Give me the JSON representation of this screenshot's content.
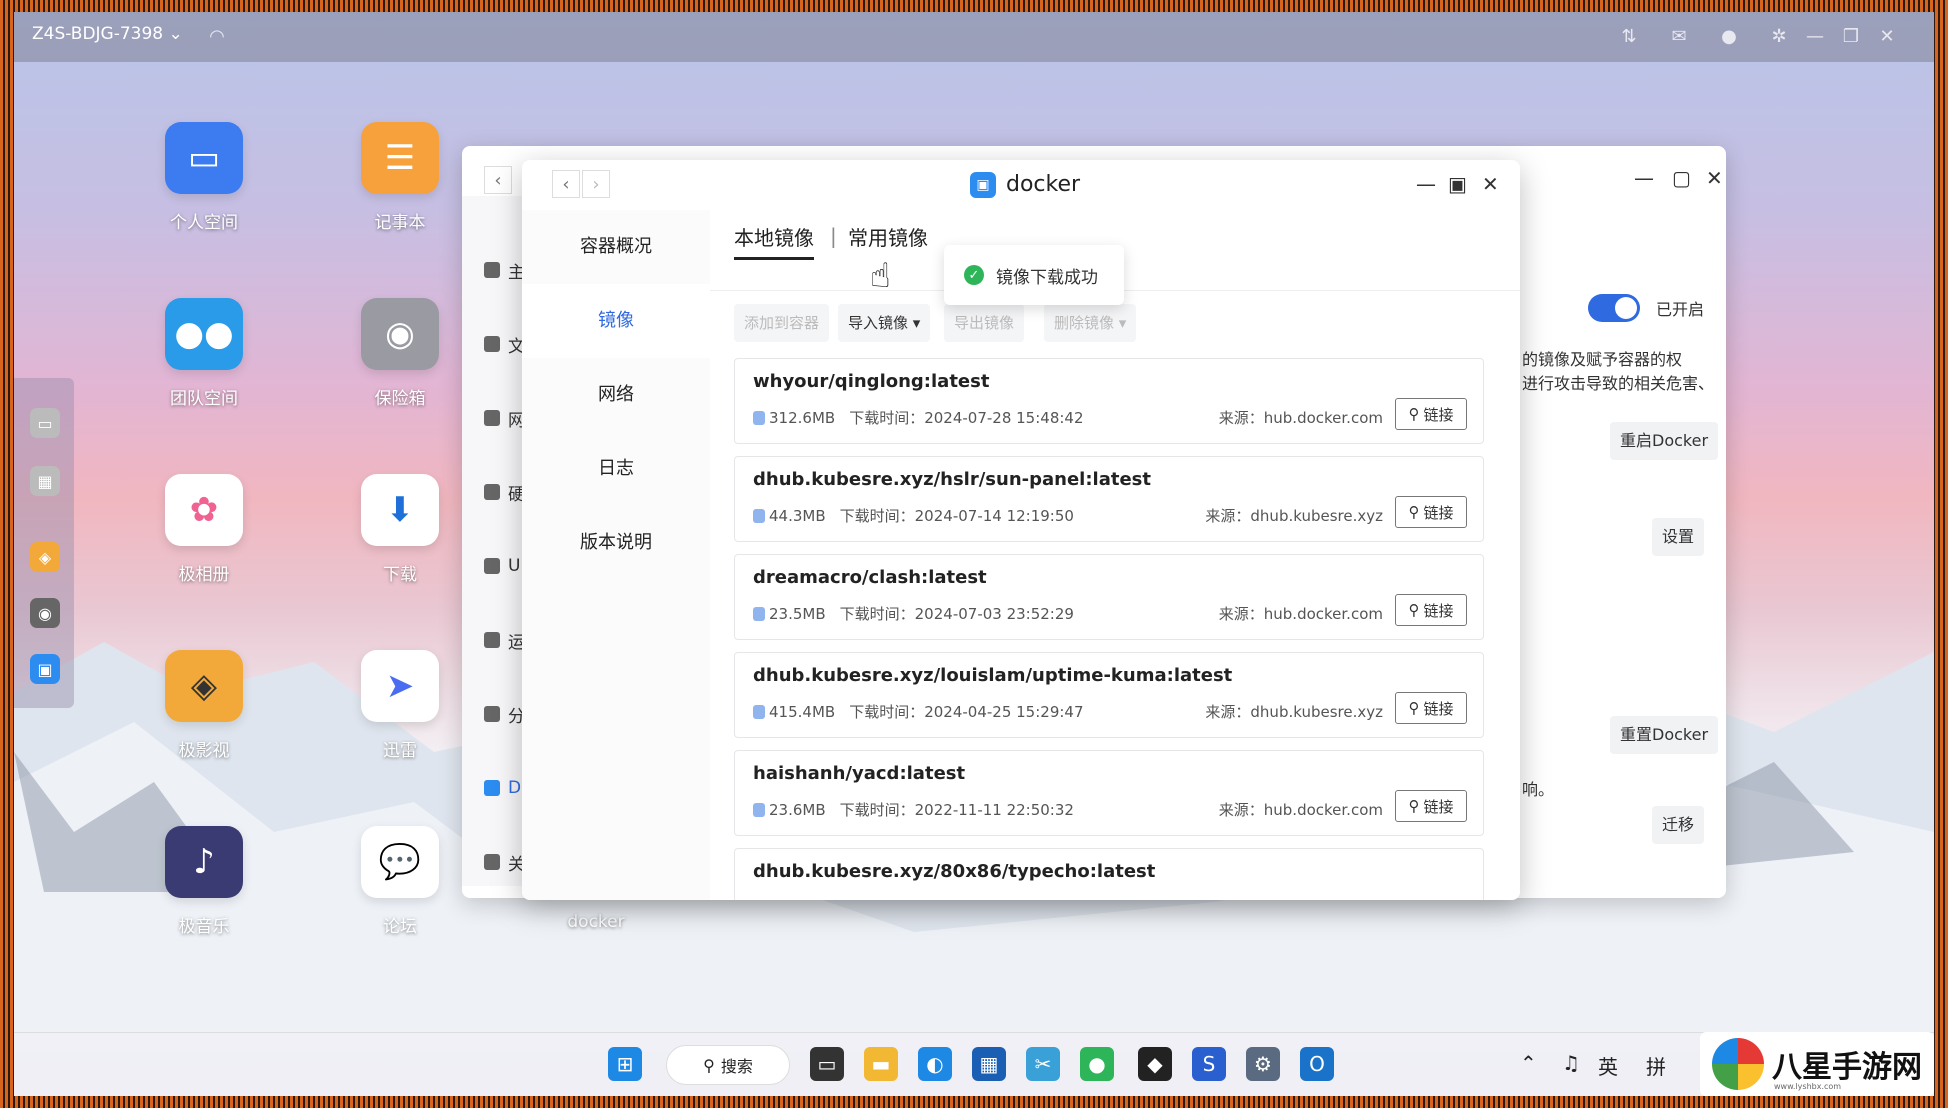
{
  "topbar": {
    "host": "Z4S-BDJG-7398",
    "chevron": "⌄"
  },
  "desktop": {
    "icons": [
      {
        "label": "个人空间",
        "icon": "folder-icon",
        "color": "#3d7cf0"
      },
      {
        "label": "记事本",
        "icon": "notepad-icon",
        "color": "#f6a13c"
      },
      {
        "label": "团队空间",
        "icon": "team-folder-icon",
        "color": "#2a9be8"
      },
      {
        "label": "保险箱",
        "icon": "safe-icon",
        "color": "#9a9aa3"
      },
      {
        "label": "极相册",
        "icon": "photos-icon",
        "color": "#ffffff"
      },
      {
        "label": "下载",
        "icon": "download-icon",
        "color": "#ffffff"
      },
      {
        "label": "极影视",
        "icon": "video-icon",
        "color": "#f2a93a"
      },
      {
        "label": "迅雷",
        "icon": "xunlei-icon",
        "color": "#ffffff"
      },
      {
        "label": "极音乐",
        "icon": "music-icon",
        "color": "#3b3b74"
      },
      {
        "label": "论坛",
        "icon": "forum-icon",
        "color": "#ffffff"
      },
      {
        "label": "docker",
        "icon": "docker-icon",
        "color": "#2d8cf0"
      }
    ]
  },
  "back_window": {
    "sidebar": [
      "主",
      "文",
      "网",
      "硬",
      "U",
      "运",
      "分",
      "D",
      "关"
    ],
    "toggle_label": "已开启",
    "text1": "的镜像及赋予容器的权",
    "text2": "进行攻击导致的相关危害、",
    "text3": "响。",
    "btn_restart": "重启Docker",
    "btn_settings": "设置",
    "btn_reset": "重置Docker",
    "btn_migrate": "迁移"
  },
  "docker": {
    "title": "docker",
    "sidebar": [
      "容器概况",
      "镜像",
      "网络",
      "日志",
      "版本说明"
    ],
    "tabs": {
      "local": "本地镜像",
      "sep": "|",
      "common": "常用镜像"
    },
    "toolbar": {
      "add": "添加到容器",
      "import": "导入镜像",
      "export": "导出镜像",
      "delete": "删除镜像"
    },
    "images": [
      {
        "name": "whyour/qinglong:latest",
        "size": "312.6MB",
        "time": "下载时间：2024-07-28 15:48:42",
        "source": "来源：hub.docker.com",
        "link": "链接"
      },
      {
        "name": "dhub.kubesre.xyz/hslr/sun-panel:latest",
        "size": "44.3MB",
        "time": "下载时间：2024-07-14 12:19:50",
        "source": "来源：dhub.kubesre.xyz",
        "link": "链接"
      },
      {
        "name": "dreamacro/clash:latest",
        "size": "23.5MB",
        "time": "下载时间：2024-07-03 23:52:29",
        "source": "来源：hub.docker.com",
        "link": "链接"
      },
      {
        "name": "dhub.kubesre.xyz/louislam/uptime-kuma:latest",
        "size": "415.4MB",
        "time": "下载时间：2024-04-25 15:29:47",
        "source": "来源：dhub.kubesre.xyz",
        "link": "链接"
      },
      {
        "name": "haishanh/yacd:latest",
        "size": "23.6MB",
        "time": "下载时间：2022-11-11 22:50:32",
        "source": "来源：hub.docker.com",
        "link": "链接"
      },
      {
        "name": "dhub.kubesre.xyz/80x86/typecho:latest"
      }
    ],
    "toast": "镜像下载成功"
  },
  "taskbar": {
    "search": "搜索",
    "tray": {
      "lang1": "英",
      "lang2": "拼"
    }
  },
  "watermark": {
    "text": "八星手游网",
    "url": "www.lyshbx.com"
  }
}
